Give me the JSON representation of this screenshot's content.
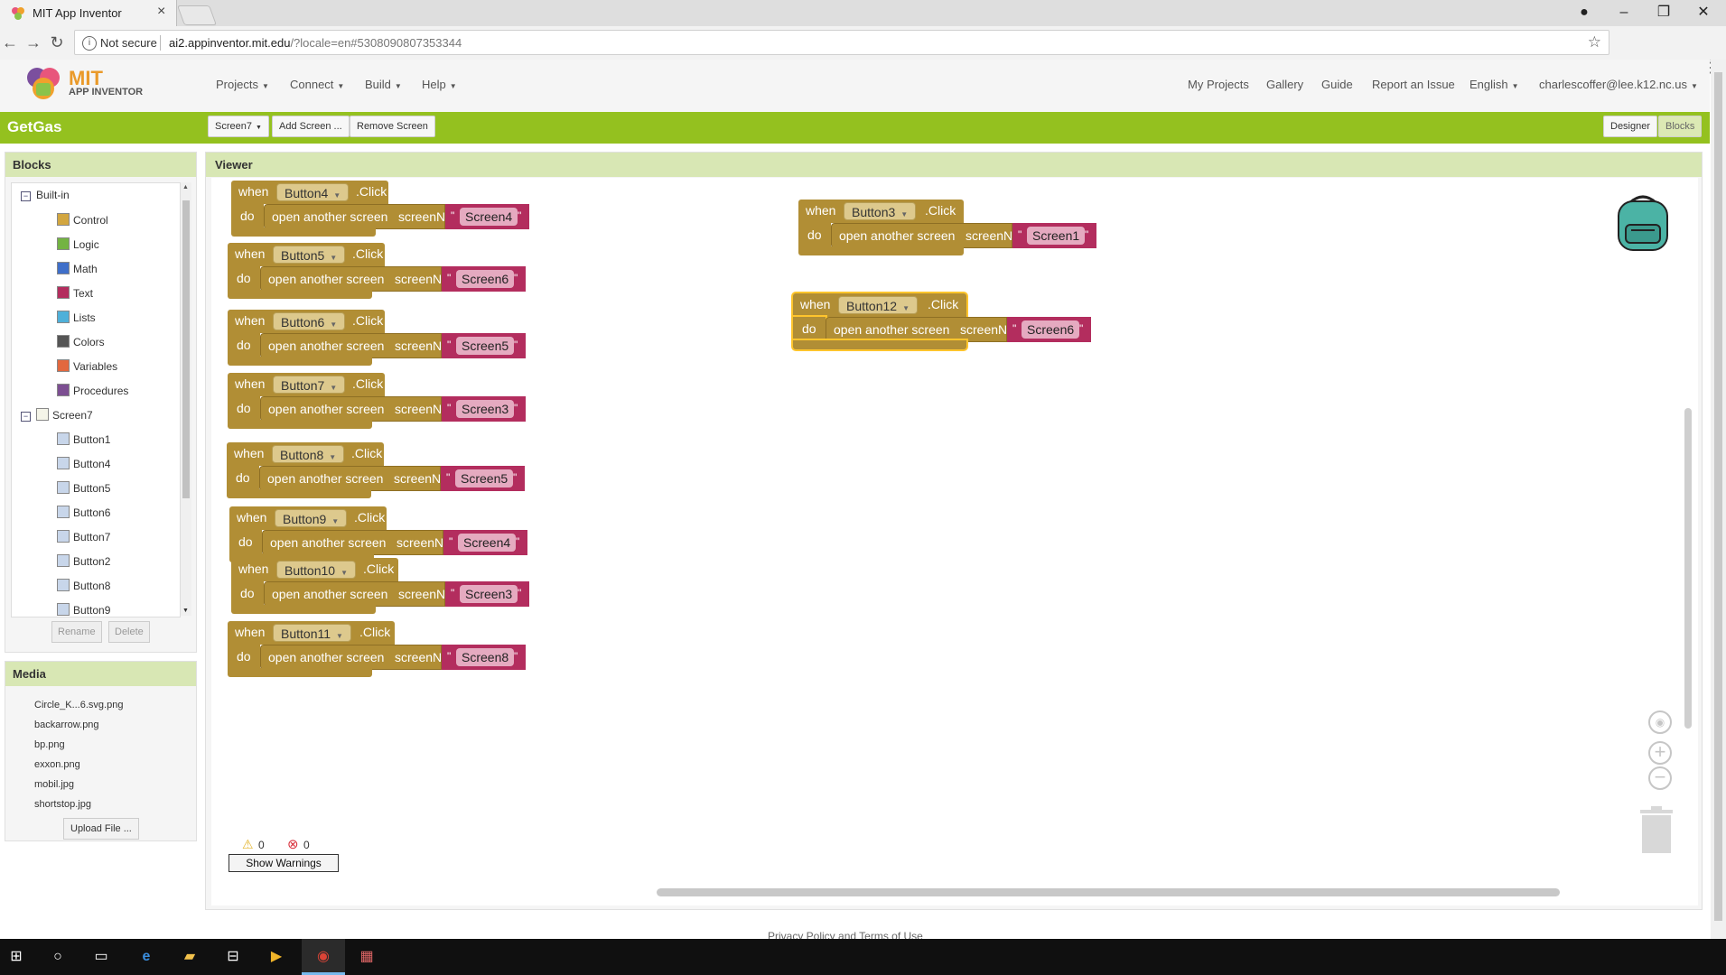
{
  "browser": {
    "tab_title": "MIT App Inventor",
    "not_secure": "Not secure",
    "url_host": "ai2.appinventor.mit.edu",
    "url_rest": "/?locale=en#5308090807353344"
  },
  "app": {
    "logo_mit": "MIT",
    "logo_sub": "APP INVENTOR",
    "menus": [
      "Projects",
      "Connect",
      "Build",
      "Help"
    ],
    "right_links": [
      "My Projects",
      "Gallery",
      "Guide",
      "Report an Issue"
    ],
    "language": "English",
    "user": "charlescoffer@lee.k12.nc.us"
  },
  "toolbar": {
    "project": "GetGas",
    "screen_select": "Screen7",
    "add_screen": "Add Screen ...",
    "remove_screen": "Remove Screen",
    "designer": "Designer",
    "blocks": "Blocks"
  },
  "blocks_panel": {
    "title": "Blocks",
    "builtin": "Built-in",
    "builtin_items": [
      {
        "label": "Control",
        "color": "#d2a640"
      },
      {
        "label": "Logic",
        "color": "#73b342"
      },
      {
        "label": "Math",
        "color": "#3f6fc9"
      },
      {
        "label": "Text",
        "color": "#b32d5e"
      },
      {
        "label": "Lists",
        "color": "#4fb0d9"
      },
      {
        "label": "Colors",
        "color": "#555555"
      },
      {
        "label": "Variables",
        "color": "#e2683e"
      },
      {
        "label": "Procedures",
        "color": "#7d4f92"
      }
    ],
    "screen": "Screen7",
    "components": [
      "Button1",
      "Button4",
      "Button5",
      "Button6",
      "Button7",
      "Button2",
      "Button8",
      "Button9"
    ],
    "rename": "Rename",
    "delete": "Delete"
  },
  "media_panel": {
    "title": "Media",
    "files": [
      "Circle_K...6.svg.png",
      "backarrow.png",
      "bp.png",
      "exxon.png",
      "mobil.jpg",
      "shortstop.jpg"
    ],
    "upload": "Upload File ..."
  },
  "viewer": {
    "title": "Viewer",
    "kw_when": "when",
    "kw_do": "do",
    "kw_click": ".Click",
    "kw_open": "open another screen",
    "kw_screenname": "screenName",
    "kw_quote": "\"",
    "blocks": [
      {
        "component": "Button4",
        "screen": "Screen4"
      },
      {
        "component": "Button5",
        "screen": "Screen6"
      },
      {
        "component": "Button6",
        "screen": "Screen5"
      },
      {
        "component": "Button7",
        "screen": "Screen3"
      },
      {
        "component": "Button8",
        "screen": "Screen5"
      },
      {
        "component": "Button9",
        "screen": "Screen4"
      },
      {
        "component": "Button10",
        "screen": "Screen3"
      },
      {
        "component": "Button11",
        "screen": "Screen8"
      },
      {
        "component": "Button3",
        "screen": "Screen1"
      },
      {
        "component": "Button12",
        "screen": "Screen6"
      }
    ],
    "warnings_count": "0",
    "errors_count": "0",
    "show_warnings": "Show Warnings"
  },
  "footer": "Privacy Policy and Terms of Use",
  "colors": {
    "green_bar": "#94c11f",
    "event_block": "#b18e35",
    "text_block": "#b32d5e"
  }
}
